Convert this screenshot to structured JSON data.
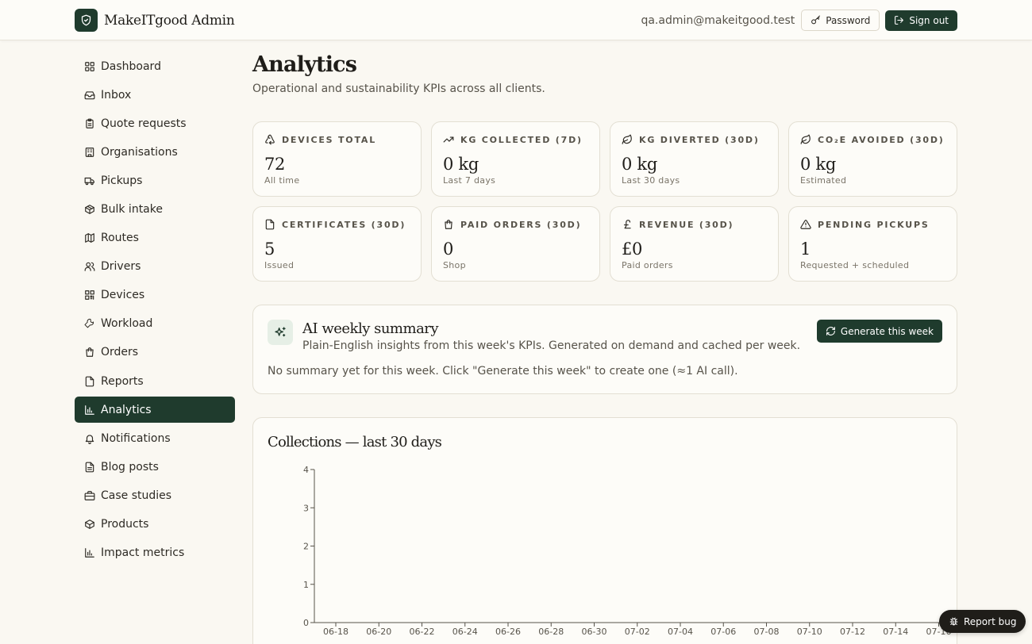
{
  "header": {
    "brand": "MakeITgood Admin",
    "email": "qa.admin@makeitgood.test",
    "password_label": "Password",
    "signout_label": "Sign out"
  },
  "sidebar": {
    "items": [
      {
        "label": "Dashboard",
        "icon": "dashboard-icon"
      },
      {
        "label": "Inbox",
        "icon": "inbox-icon"
      },
      {
        "label": "Quote requests",
        "icon": "clipboard-icon"
      },
      {
        "label": "Organisations",
        "icon": "building-icon"
      },
      {
        "label": "Pickups",
        "icon": "truck-icon"
      },
      {
        "label": "Bulk intake",
        "icon": "package-icon"
      },
      {
        "label": "Routes",
        "icon": "map-icon"
      },
      {
        "label": "Drivers",
        "icon": "users-icon"
      },
      {
        "label": "Devices",
        "icon": "qr-icon"
      },
      {
        "label": "Workload",
        "icon": "wrench-icon"
      },
      {
        "label": "Orders",
        "icon": "shopping-bag-icon"
      },
      {
        "label": "Reports",
        "icon": "file-icon"
      },
      {
        "label": "Analytics",
        "icon": "bar-chart-icon",
        "active": true
      },
      {
        "label": "Notifications",
        "icon": "bell-icon"
      },
      {
        "label": "Blog posts",
        "icon": "file-text-icon"
      },
      {
        "label": "Case studies",
        "icon": "briefcase-icon"
      },
      {
        "label": "Products",
        "icon": "box-icon"
      },
      {
        "label": "Impact metrics",
        "icon": "bar-chart-icon"
      }
    ]
  },
  "page": {
    "title": "Analytics",
    "subtitle": "Operational and sustainability KPIs across all clients."
  },
  "kpis": [
    {
      "label": "DEVICES TOTAL",
      "value": "72",
      "sub": "All time",
      "icon": "recycle-icon"
    },
    {
      "label": "KG COLLECTED (7D)",
      "value": "0 kg",
      "sub": "Last 7 days",
      "icon": "trending-up-icon"
    },
    {
      "label": "KG DIVERTED (30D)",
      "value": "0 kg",
      "sub": "Last 30 days",
      "icon": "leaf-icon"
    },
    {
      "label": "CO₂E AVOIDED (30D)",
      "value": "0 kg",
      "sub": "Estimated",
      "icon": "leaf-icon"
    },
    {
      "label": "CERTIFICATES (30D)",
      "value": "5",
      "sub": "Issued",
      "icon": "file-icon"
    },
    {
      "label": "PAID ORDERS (30D)",
      "value": "0",
      "sub": "Shop",
      "icon": "shopping-bag-icon"
    },
    {
      "label": "REVENUE (30D)",
      "value": "£0",
      "sub": "Paid orders",
      "icon": "pound-icon"
    },
    {
      "label": "PENDING PICKUPS",
      "value": "1",
      "sub": "Requested + scheduled",
      "icon": "alert-triangle-icon"
    }
  ],
  "ai_summary": {
    "title": "AI weekly summary",
    "subtitle": "Plain-English insights from this week's KPIs. Generated on demand and cached per week.",
    "empty": "No summary yet for this week. Click \"Generate this week\" to create one (≈1 AI call).",
    "button": "Generate this week"
  },
  "chart_data": {
    "type": "line",
    "title": "Collections — last 30 days",
    "xlabel": "",
    "ylabel": "",
    "ylim": [
      0,
      4
    ],
    "yticks": [
      "0",
      "1",
      "2",
      "3",
      "4"
    ],
    "x": [
      "06-18",
      "06-20",
      "06-22",
      "06-24",
      "06-26",
      "06-28",
      "06-30",
      "07-02",
      "07-04",
      "07-06",
      "07-08",
      "07-10",
      "07-12",
      "07-14",
      "07-16"
    ],
    "series": [],
    "grid": false
  },
  "report_bug": "Report bug",
  "colors": {
    "brand": "#1f3b2d",
    "background": "#faf8f2",
    "card": "#fdfcf8"
  }
}
